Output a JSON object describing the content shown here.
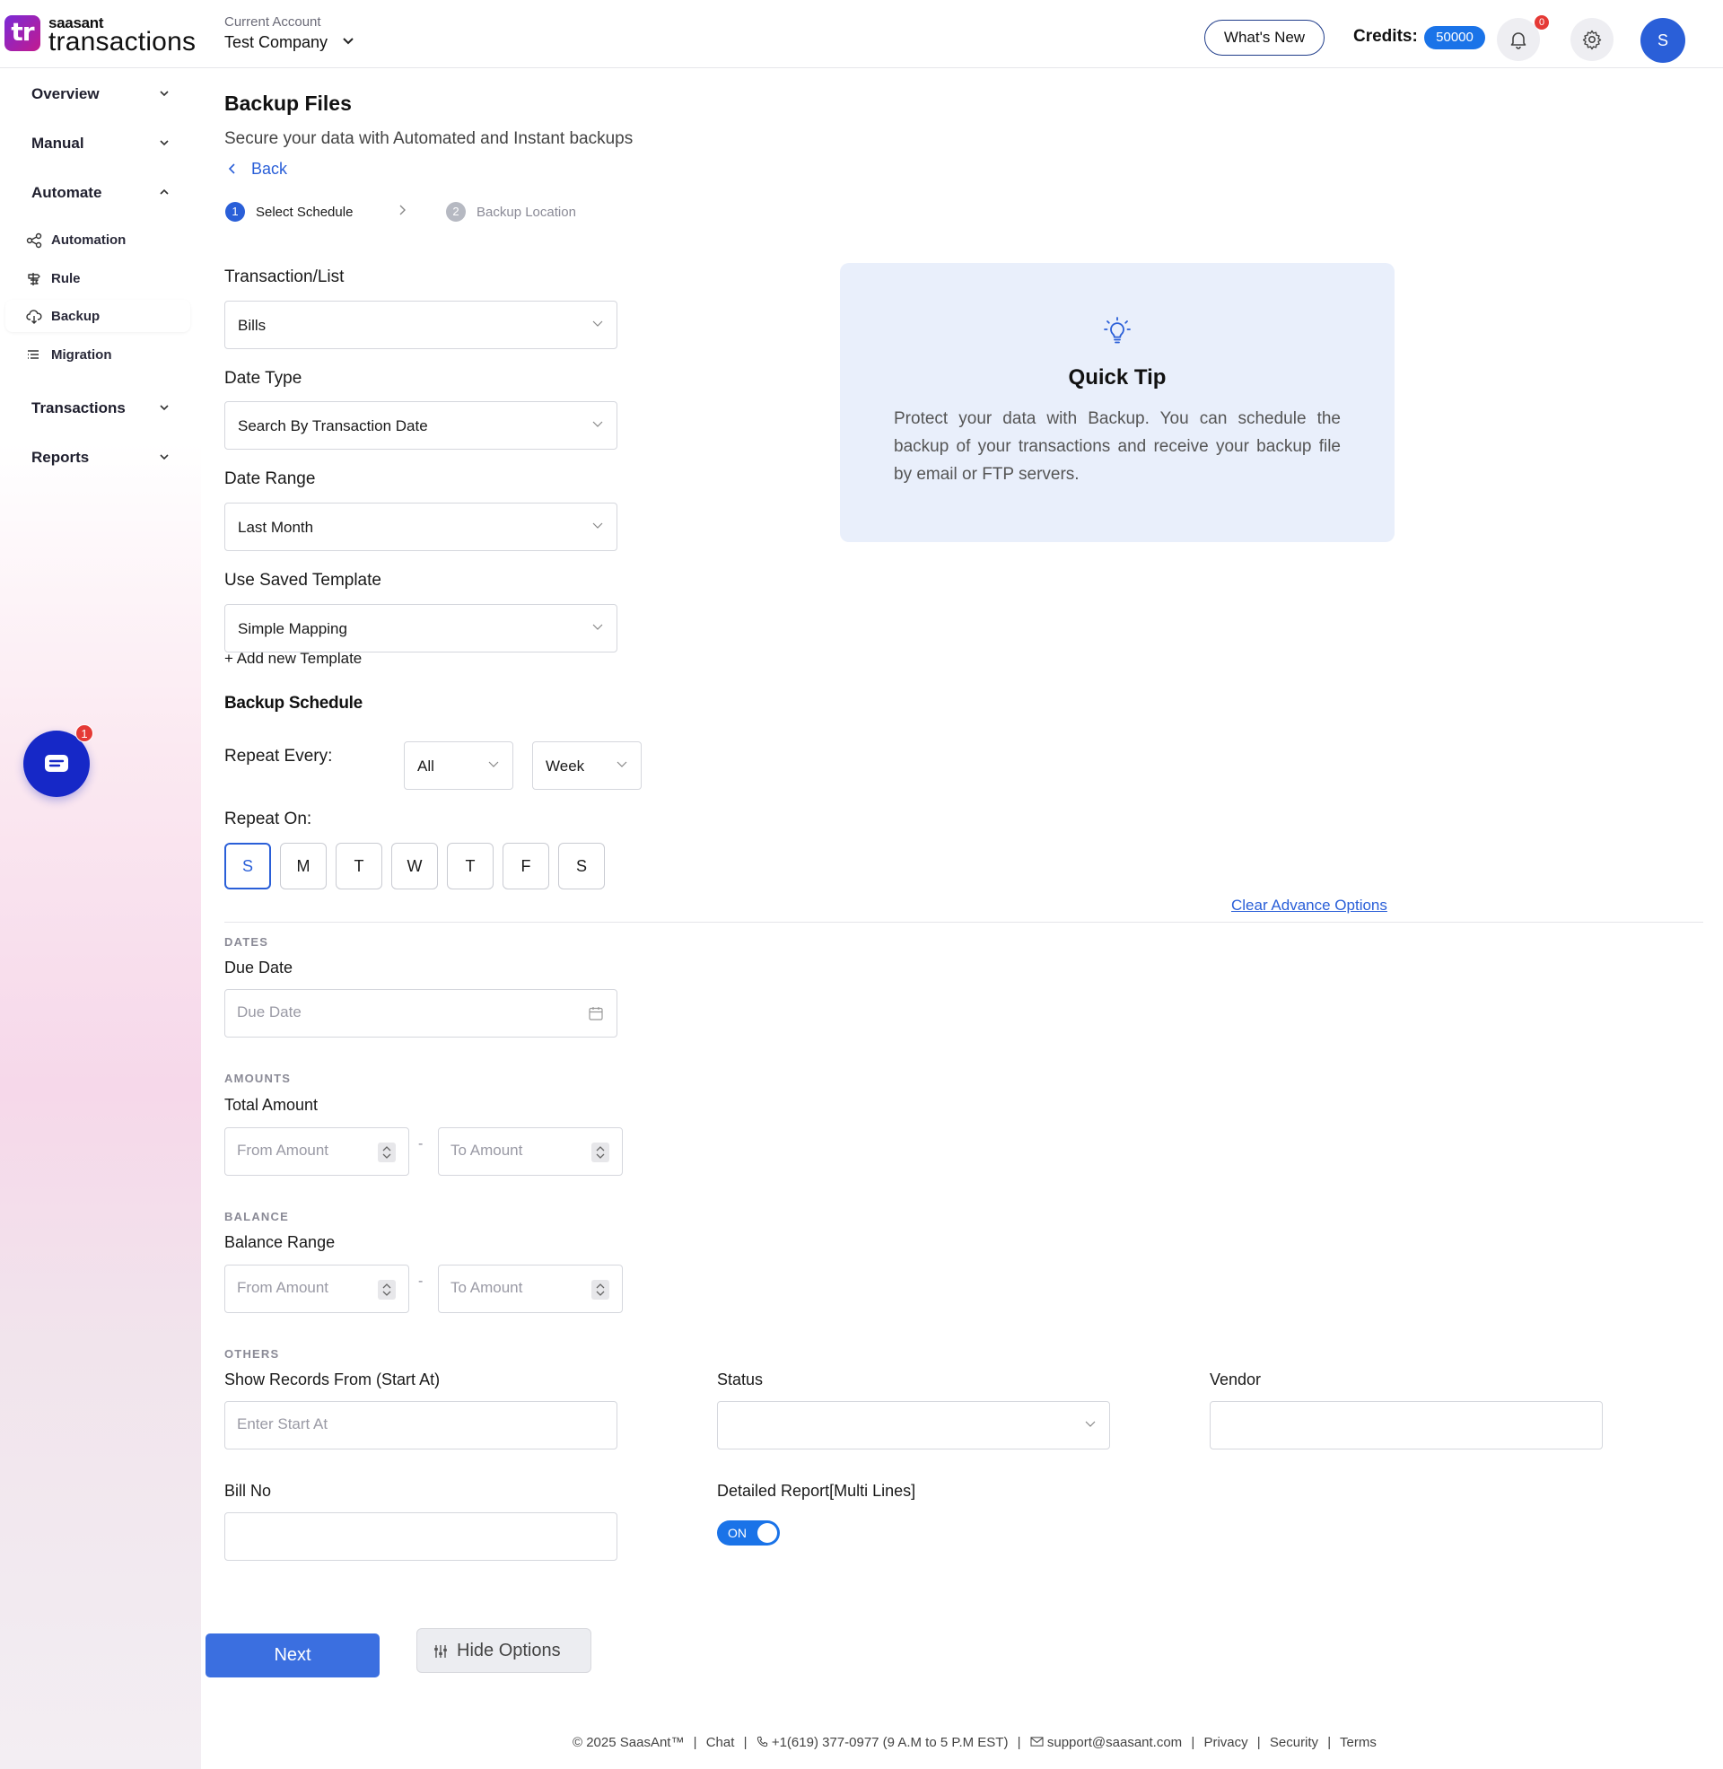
{
  "header": {
    "logo_small": "saasant",
    "logo_big": "transactions",
    "logo_mark": "tr",
    "account_label": "Current Account",
    "account_name": "Test Company",
    "whats_new": "What's New",
    "credits_label": "Credits:",
    "credits_value": "50000",
    "notification_count": "0",
    "avatar_initial": "S"
  },
  "sidebar": {
    "overview": "Overview",
    "manual": "Manual",
    "automate": "Automate",
    "sub_items": [
      {
        "label": "Automation",
        "icon": "share-nodes-icon"
      },
      {
        "label": "Rule",
        "icon": "signpost-icon"
      },
      {
        "label": "Backup",
        "icon": "cloud-backup-icon",
        "active": true
      },
      {
        "label": "Migration",
        "icon": "list-icon"
      }
    ],
    "transactions": "Transactions",
    "reports": "Reports",
    "chat_badge": "1"
  },
  "main": {
    "title": "Backup Files",
    "subtitle": "Secure your data with Automated and Instant backups",
    "back": "Back",
    "steps": [
      {
        "number": "1",
        "label": "Select Schedule",
        "active": true
      },
      {
        "number": "2",
        "label": "Backup Location",
        "active": false
      }
    ],
    "transaction_list_label": "Transaction/List",
    "transaction_list_value": "Bills",
    "date_type_label": "Date Type",
    "date_type_value": "Search By Transaction Date",
    "date_range_label": "Date Range",
    "date_range_value": "Last Month",
    "template_label": "Use Saved Template",
    "template_value": "Simple Mapping",
    "add_template": "+ Add new Template",
    "backup_schedule": "Backup Schedule",
    "repeat_every_label": "Repeat Every:",
    "repeat_every_value1": "All",
    "repeat_every_value2": "Week",
    "repeat_on_label": "Repeat On:",
    "days": [
      "S",
      "M",
      "T",
      "W",
      "T",
      "F",
      "S"
    ],
    "selected_day_index": 0,
    "clear_advance": "Clear Advance Options",
    "dates_section": "DATES",
    "due_date_label": "Due Date",
    "due_date_placeholder": "Due Date",
    "amounts_section": "AMOUNTS",
    "total_amount_label": "Total Amount",
    "from_amount_placeholder": "From Amount",
    "to_amount_placeholder": "To Amount",
    "dash": "-",
    "balance_section": "BALANCE",
    "balance_range_label": "Balance Range",
    "others_section": "OTHERS",
    "show_records_label": "Show Records From (Start At)",
    "show_records_placeholder": "Enter Start At",
    "status_label": "Status",
    "vendor_label": "Vendor",
    "bill_no_label": "Bill No",
    "detailed_report_label": "Detailed Report[Multi Lines]",
    "toggle_state": "ON",
    "next": "Next",
    "hide_options": "Hide Options"
  },
  "quick_tip": {
    "title": "Quick Tip",
    "text": "Protect your data with Backup. You can schedule the backup of your transactions and receive your backup file by email or FTP servers."
  },
  "footer": {
    "copyright": "© 2025 SaasAnt™",
    "chat": "Chat",
    "phone": "+1(619) 377-0977 (9 A.M to 5 P.M EST)",
    "email": "support@saasant.com",
    "privacy": "Privacy",
    "security": "Security",
    "terms": "Terms"
  },
  "colors": {
    "accent": "#2a5fd8",
    "credits_badge": "#1a73e8",
    "chat_fab": "#1628c7",
    "badge_red": "#e53935",
    "tip_background": "#e9effb"
  }
}
